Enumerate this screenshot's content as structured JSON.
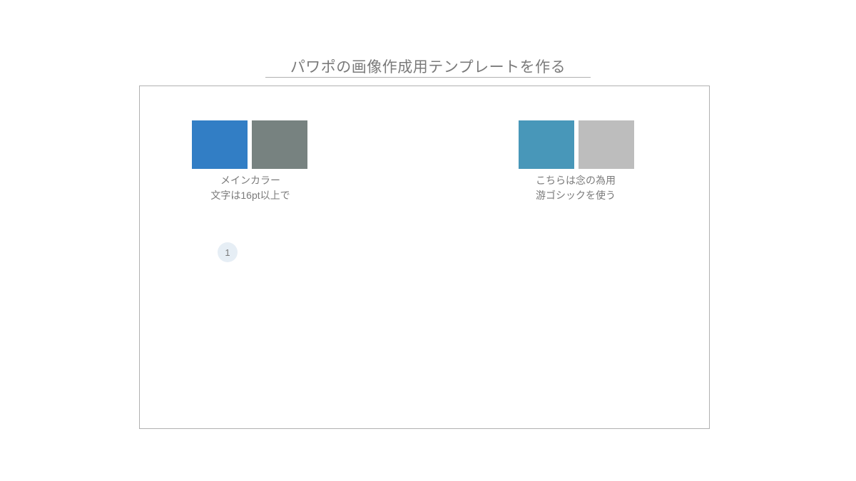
{
  "title": "パワポの画像作成用テンプレートを作る",
  "left": {
    "color1": "#327ec5",
    "color2": "#778280",
    "line1": "メインカラー",
    "line2": "文字は16pt以上で"
  },
  "right": {
    "color1": "#4897b9",
    "color2": "#bdbdbd",
    "line1": "こちらは念の為用",
    "line2": "游ゴシックを使う"
  },
  "bullet": "1"
}
